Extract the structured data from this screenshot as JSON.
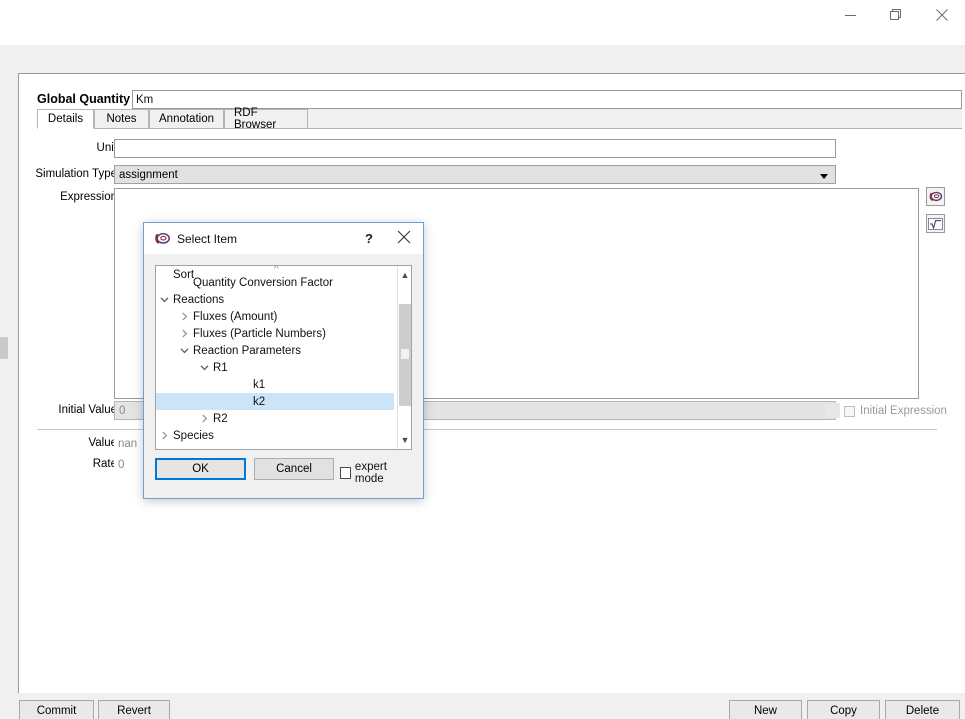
{
  "window": {
    "controls": [
      {
        "name": "minimize",
        "glyph": "minimize-icon"
      },
      {
        "name": "restore",
        "glyph": "restore-icon"
      },
      {
        "name": "close",
        "glyph": "close-icon"
      }
    ]
  },
  "header": {
    "label": "Global Quantity",
    "name_value": "Km"
  },
  "tabs": [
    {
      "label": "Details",
      "active": true
    },
    {
      "label": "Notes",
      "active": false
    },
    {
      "label": "Annotation",
      "active": false
    },
    {
      "label": "RDF Browser",
      "active": false
    }
  ],
  "form": {
    "unit_label": "Unit",
    "unit_value": "",
    "simulation_type_label": "Simulation Type",
    "simulation_type_value": "assignment",
    "expression_label": "Expression",
    "expression_value": "",
    "initial_value_label": "Initial Value",
    "initial_value": "0",
    "initial_expression_label": "Initial Expression",
    "value_label": "Value",
    "value": "nan",
    "rate_label": "Rate",
    "rate": "0"
  },
  "side_buttons": [
    {
      "name": "copasi-object-browser-icon"
    },
    {
      "name": "math-expression-icon"
    }
  ],
  "bottom_bar": {
    "commit": "Commit",
    "revert": "Revert",
    "new": "New",
    "copy": "Copy",
    "delete": "Delete"
  },
  "dialog": {
    "title": "Select Item",
    "help_glyph": "?",
    "sort_label": "Sort",
    "tree": [
      {
        "label": "Quantity Conversion Factor",
        "indent": 1,
        "chevron": "none",
        "selected": false
      },
      {
        "label": "Reactions",
        "indent": 0,
        "chevron": "down",
        "selected": false
      },
      {
        "label": "Fluxes (Amount)",
        "indent": 1,
        "chevron": "right",
        "selected": false
      },
      {
        "label": "Fluxes (Particle Numbers)",
        "indent": 1,
        "chevron": "right",
        "selected": false
      },
      {
        "label": "Reaction Parameters",
        "indent": 1,
        "chevron": "down",
        "selected": false
      },
      {
        "label": "R1",
        "indent": 2,
        "chevron": "down",
        "selected": false
      },
      {
        "label": "k1",
        "indent": 4,
        "chevron": "none",
        "selected": false
      },
      {
        "label": "k2",
        "indent": 4,
        "chevron": "none",
        "selected": true
      },
      {
        "label": "R2",
        "indent": 2,
        "chevron": "right",
        "selected": false
      },
      {
        "label": "Species",
        "indent": 0,
        "chevron": "right",
        "selected": false
      }
    ],
    "ok_label": "OK",
    "cancel_label": "Cancel",
    "expert_mode_label": "expert mode",
    "expert_mode_checked": false,
    "accent_color": "#0078d7",
    "selection_color": "#cce4f7"
  }
}
